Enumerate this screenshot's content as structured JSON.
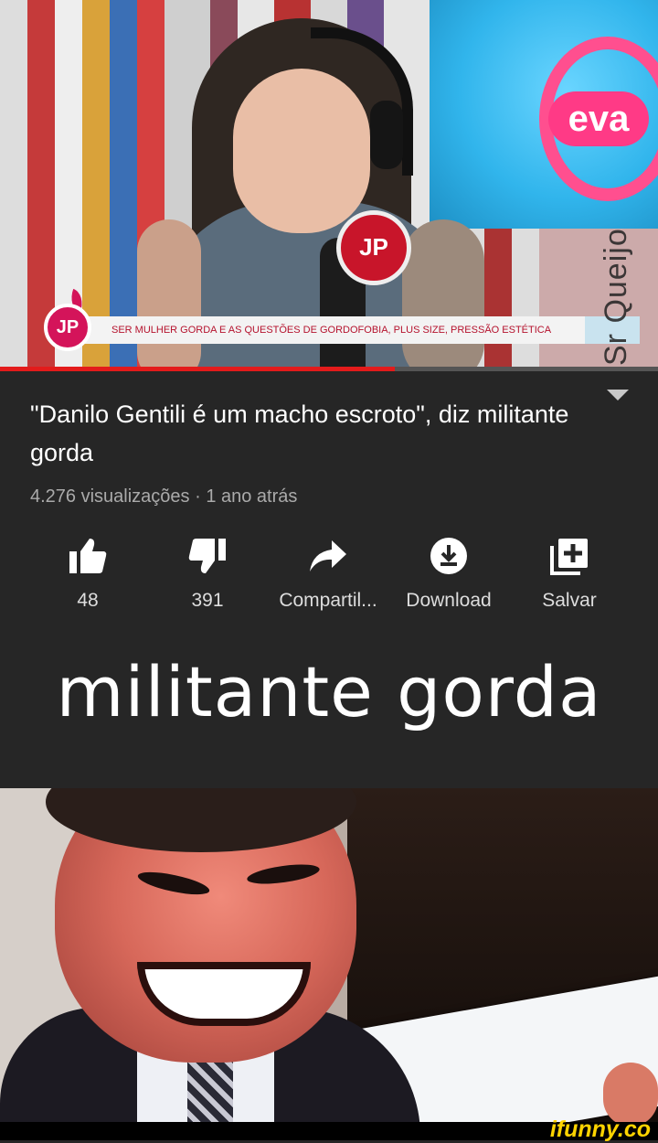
{
  "video": {
    "lower_third": "SER MULHER GORDA E AS QUESTÕES DE GORDOFOBIA, PLUS SIZE, PRESSÃO ESTÉTICA",
    "logo_text": "JP",
    "screen_brand": "eva",
    "mic_brand": "JP",
    "watermark": "Sr Queijo",
    "progress": 0.6
  },
  "meta": {
    "title": "\"Danilo Gentili é um macho escroto\", diz militante gorda",
    "stats": "4.276 visualizações · 1 ano atrás"
  },
  "actions": [
    {
      "icon": "thumbs-up-icon",
      "label": "48"
    },
    {
      "icon": "thumbs-down-icon",
      "label": "391"
    },
    {
      "icon": "share-icon",
      "label": "Compartil..."
    },
    {
      "icon": "download-icon",
      "label": "Download"
    },
    {
      "icon": "save-to-playlist-icon",
      "label": "Salvar"
    }
  ],
  "caption": "militante gorda",
  "footer": {
    "brand": "ifunny.co"
  },
  "colors": {
    "background": "#262626",
    "progress": "#e31b1b",
    "stats_text": "#aaaaaa",
    "ifunny_brand": "#ffd400"
  }
}
